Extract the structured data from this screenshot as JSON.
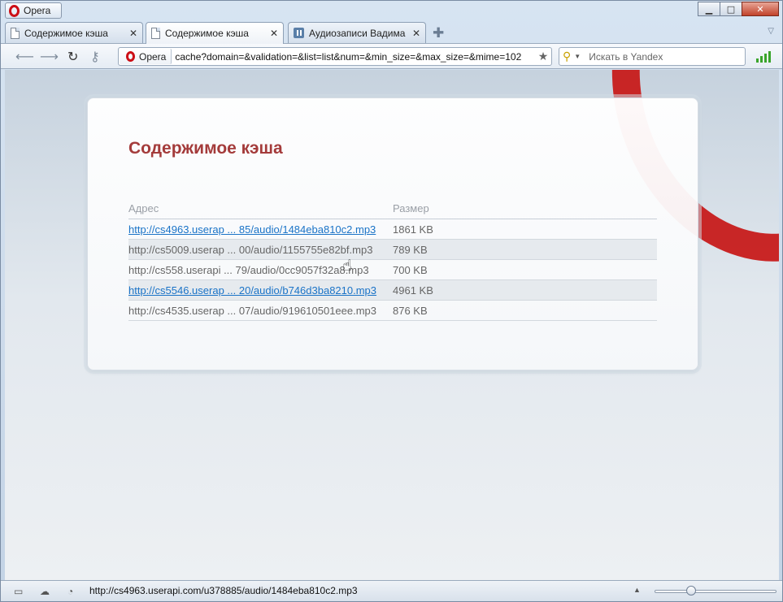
{
  "browser": {
    "menu_label": "Opera",
    "window_controls": {
      "minimize": "▁",
      "maximize": "□",
      "close": "✕"
    }
  },
  "tabs": [
    {
      "label": "Содержимое кэша",
      "icon": "page-icon",
      "active": false
    },
    {
      "label": "Содержимое кэша",
      "icon": "page-icon",
      "active": true
    },
    {
      "label": "Аудиозаписи Вадима ...",
      "icon": "audio-icon",
      "active": false
    }
  ],
  "toolbar": {
    "badge_label": "Opera",
    "url": "cache?domain=&validation=&list=list&num=&min_size=&max_size=&mime=102",
    "search_placeholder": "Искать в Yandex"
  },
  "page": {
    "title": "Содержимое кэша",
    "columns": {
      "address": "Адрес",
      "size": "Размер"
    },
    "rows": [
      {
        "address": "http://cs4963.userap ... 85/audio/1484eba810c2.mp3",
        "size": "1861 KB",
        "is_link": true
      },
      {
        "address": "http://cs5009.userap ... 00/audio/1155755e82bf.mp3",
        "size": "789 KB",
        "is_link": false
      },
      {
        "address": "http://cs558.userapi ... 79/audio/0cc9057f32a8.mp3",
        "size": "700 KB",
        "is_link": false
      },
      {
        "address": "http://cs5546.userap ... 20/audio/b746d3ba8210.mp3",
        "size": "4961 KB",
        "is_link": true
      },
      {
        "address": "http://cs4535.userap ... 07/audio/919610501eee.mp3",
        "size": "876 KB",
        "is_link": false
      }
    ]
  },
  "statusbar": {
    "hover_url": "http://cs4963.userapi.com/u378885/audio/1484eba810c2.mp3",
    "zoom_fraction": 0.28
  },
  "colors": {
    "title": "#a43b3b",
    "link": "#1a73c7",
    "opera_red": "#cc0f16",
    "signal": "#3aa52c"
  }
}
